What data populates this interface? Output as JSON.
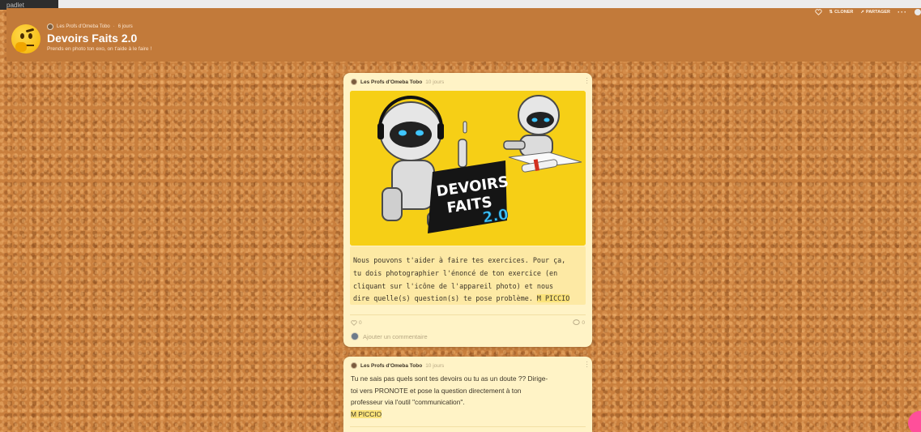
{
  "app": {
    "brand": "padlet"
  },
  "header": {
    "author": "Les Profs d'Omeba Tobo",
    "age": "6 jours",
    "title": "Devoirs Faits 2.0",
    "description": "Prends en photo ton exo, on t'aide à le faire !",
    "actions": {
      "clone_label": "CLONER",
      "share_label": "PARTAGER"
    }
  },
  "posts": [
    {
      "author": "Les Profs d'Omeba Tobo",
      "age": "10 jours",
      "image": {
        "caption_line1": "DEVOIRS",
        "caption_line2": "FAITS",
        "caption_badge": "2.0",
        "background": "#f6cf16"
      },
      "body_lines": [
        "Nous pouvons t'aider à faire tes exercices. Pour ça,",
        "tu dois photographier l'énoncé de ton exercice (en",
        "cliquant sur l'icône de l'appareil photo) et nous",
        "dire quelle(s) question(s) te pose problème. "
      ],
      "signature": "M PICCIO",
      "likes": "0",
      "comments": "0",
      "comment_placeholder": "Ajouter un commentaire"
    },
    {
      "author": "Les Profs d'Omeba Tobo",
      "age": "10 jours",
      "body_lines": [
        "Tu ne sais pas quels sont tes devoirs ou tu as un doute ?? Dirige-",
        "toi vers PRONOTE et pose la question directement à ton",
        "professeur via l'outil \"communication\"."
      ],
      "signature": "M PICCIO"
    }
  ],
  "colors": {
    "board": "#c97f3d",
    "header": "#c27a3a",
    "card": "#fff3c6",
    "highlight": "#fbe37a",
    "fab": "#ff4f9a"
  }
}
